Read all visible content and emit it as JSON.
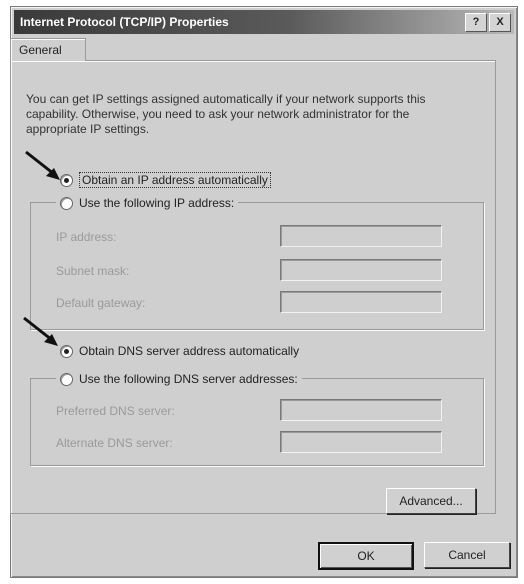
{
  "window": {
    "title": "Internet Protocol (TCP/IP) Properties",
    "help_label": "?",
    "close_label": "X"
  },
  "tabs": [
    {
      "label": "General"
    }
  ],
  "description": "You can get IP settings assigned automatically if your network supports this capability. Otherwise, you need to ask your network administrator for the appropriate IP settings.",
  "ip": {
    "auto_label": "Obtain an IP address automatically",
    "manual_label": "Use the following IP address:",
    "auto_selected": true,
    "fields": [
      {
        "label": "IP address:",
        "value": ""
      },
      {
        "label": "Subnet mask:",
        "value": ""
      },
      {
        "label": "Default gateway:",
        "value": ""
      }
    ]
  },
  "dns": {
    "auto_label": "Obtain DNS server address automatically",
    "manual_label": "Use the following DNS server addresses:",
    "auto_selected": true,
    "fields": [
      {
        "label": "Preferred DNS server:",
        "value": ""
      },
      {
        "label": "Alternate DNS server:",
        "value": ""
      }
    ]
  },
  "buttons": {
    "advanced": "Advanced...",
    "ok": "OK",
    "cancel": "Cancel"
  },
  "colors": {
    "annotation_arrow": "#111111"
  }
}
